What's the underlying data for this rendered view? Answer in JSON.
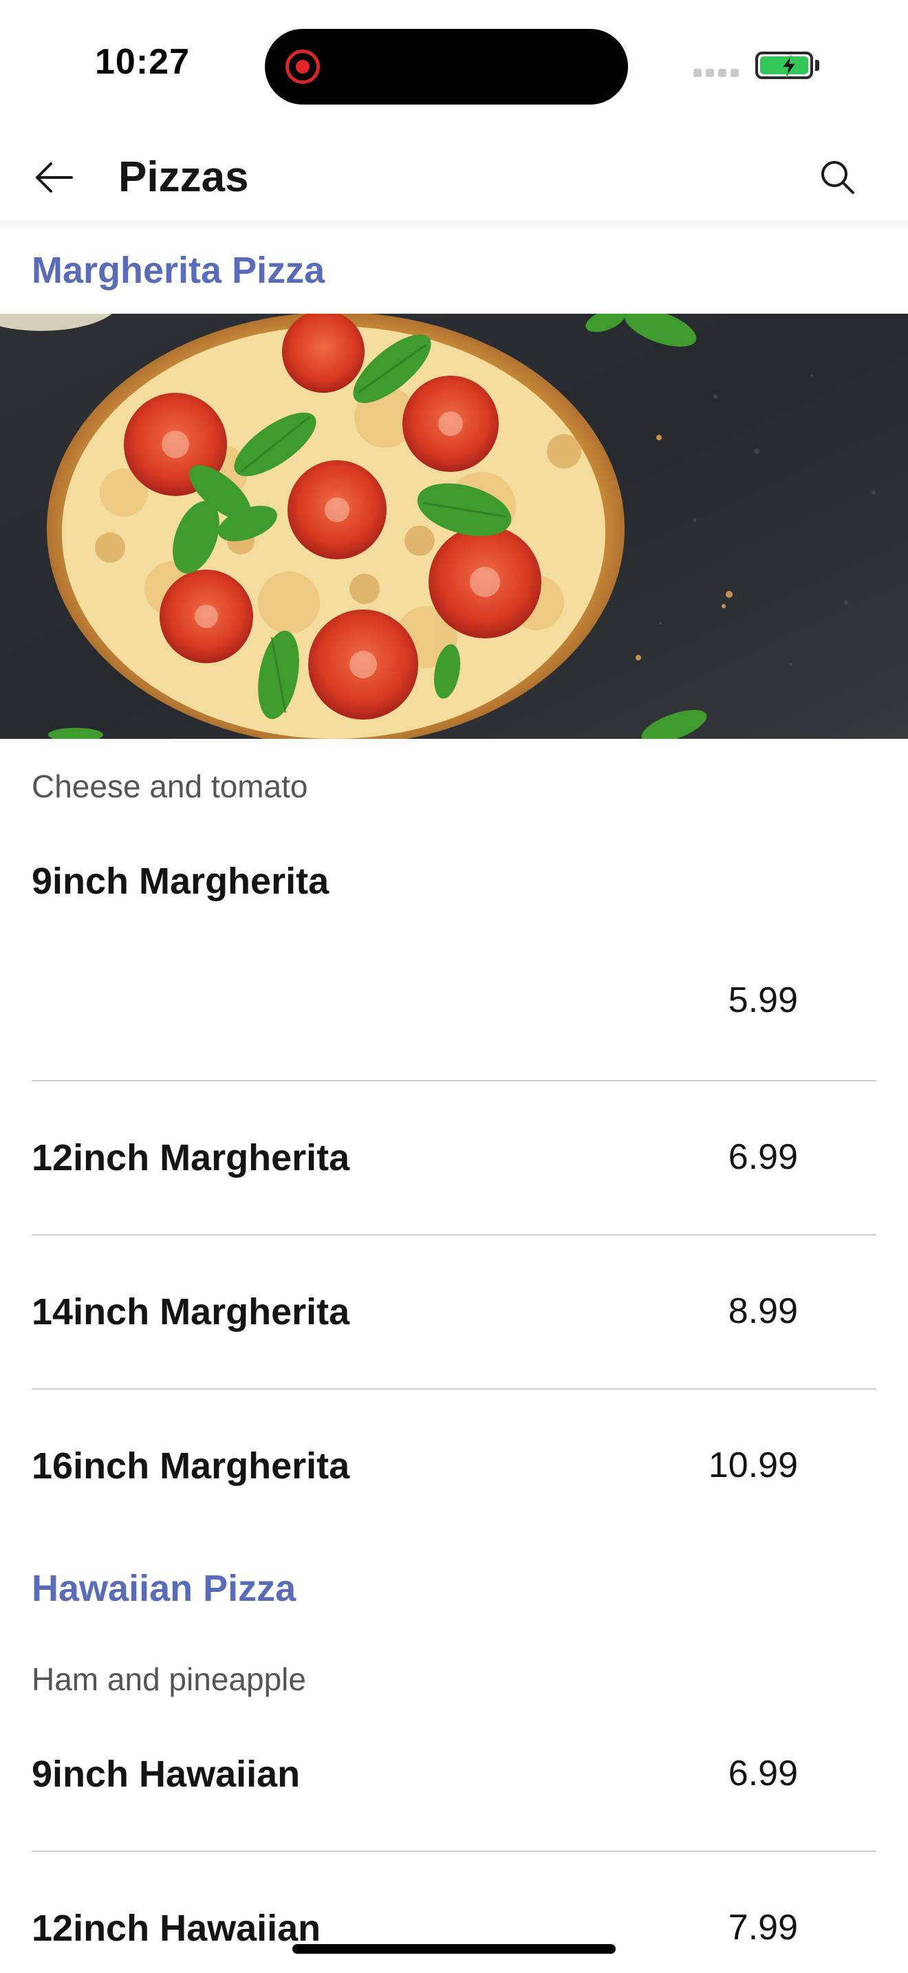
{
  "status_bar": {
    "time": "10:27",
    "battery_color": "#35c759",
    "recording_color": "#e3262b"
  },
  "header": {
    "title": "Pizzas",
    "back_icon": "arrow-left-icon",
    "search_icon": "search-icon"
  },
  "accent_color": "#5a6cb8",
  "sections": [
    {
      "title": "Margherita Pizza",
      "image": "margherita-pizza-photo",
      "description": "Cheese and tomato",
      "items": [
        {
          "name": "9inch Margherita",
          "price": "5.99"
        },
        {
          "name": "12inch Margherita",
          "price": "6.99"
        },
        {
          "name": "14inch Margherita",
          "price": "8.99"
        },
        {
          "name": "16inch Margherita",
          "price": "10.99"
        }
      ]
    },
    {
      "title": "Hawaiian Pizza",
      "description": "Ham and pineapple",
      "items": [
        {
          "name": "9inch Hawaiian",
          "price": "6.99"
        },
        {
          "name": "12inch Hawaiian",
          "price": "7.99"
        }
      ]
    }
  ]
}
